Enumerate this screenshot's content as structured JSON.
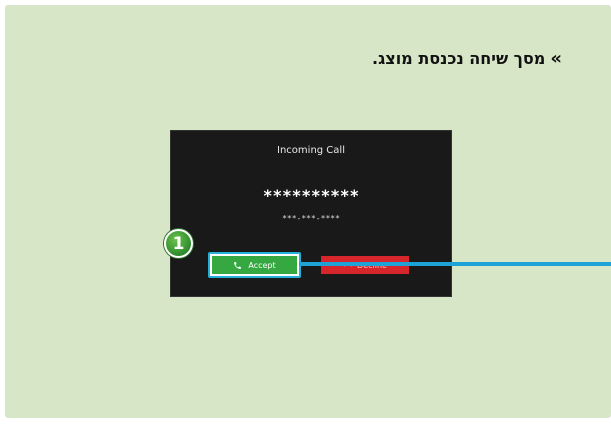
{
  "heading": {
    "chevron": "»",
    "text": "מסך שיחה נכנסת מוצג."
  },
  "screen": {
    "title": "Incoming Call",
    "caller_name": "**********",
    "caller_number": "***-***-****",
    "accept_icon": "phone-icon",
    "accept_label": "Accept",
    "decline_icon": "phone-hangup-icon",
    "decline_label": "Decline"
  },
  "callout": {
    "number": "1",
    "color": "#1da3d6"
  },
  "colors": {
    "panel_bg": "#d8e6c8",
    "screen_bg": "#191919",
    "accept_green": "#35a842",
    "decline_red": "#d6262b",
    "badge_green": "#2e8b2e"
  }
}
